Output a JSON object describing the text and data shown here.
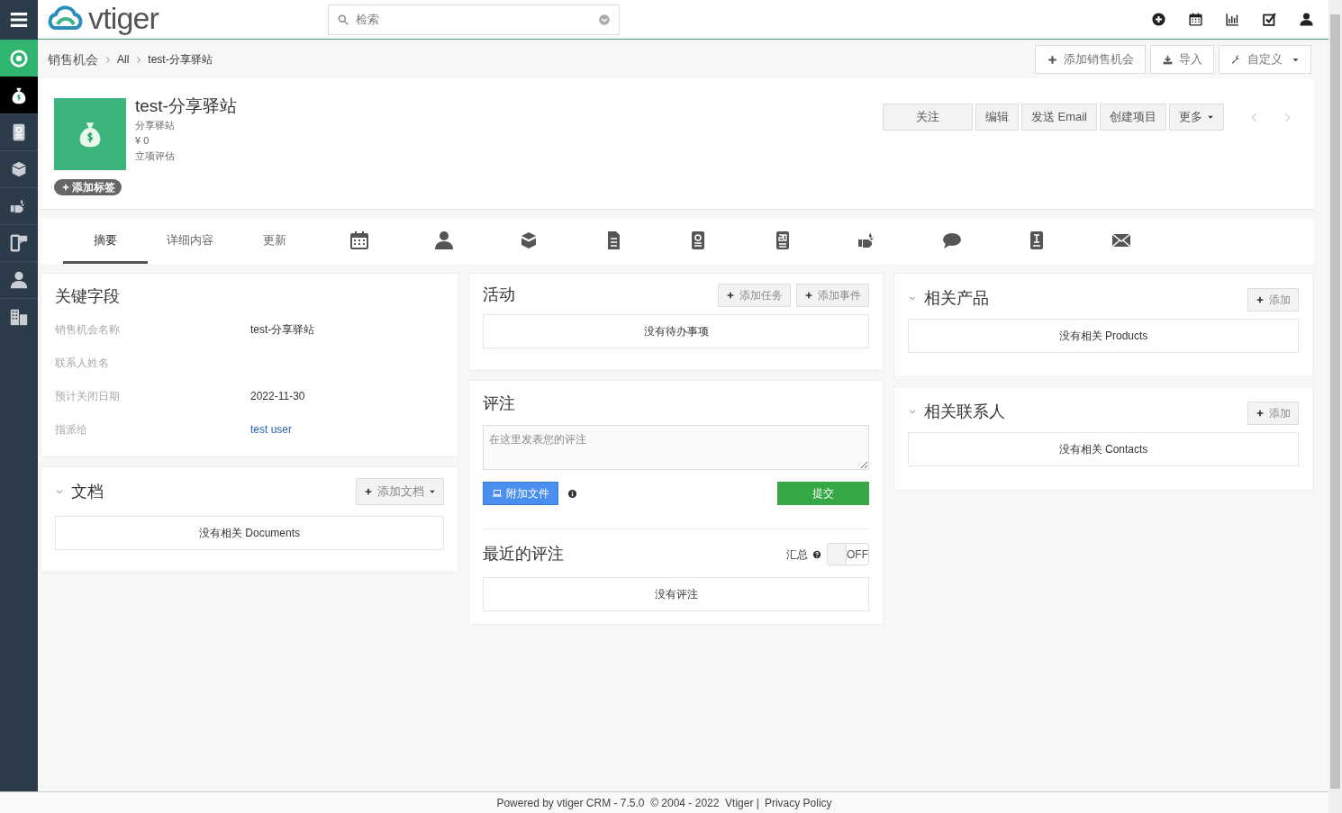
{
  "header": {
    "logo": "vtiger",
    "search": {
      "placeholder": "检索"
    },
    "icons": [
      {
        "kind": "plus"
      },
      {
        "kind": "calendar"
      },
      {
        "kind": "chart"
      },
      {
        "kind": "check"
      },
      {
        "kind": "user"
      }
    ]
  },
  "sidebar": {
    "items": [
      {
        "kind": "target",
        "selected": false
      },
      {
        "kind": "moneybag",
        "selected": true
      },
      {
        "kind": "quote",
        "selected": false
      },
      {
        "kind": "box",
        "selected": false
      },
      {
        "kind": "handshake",
        "selected": false
      },
      {
        "kind": "phone",
        "selected": false
      },
      {
        "kind": "user",
        "selected": false
      },
      {
        "kind": "building",
        "selected": false
      }
    ]
  },
  "breadcrumb": [
    "销售机会",
    "All",
    "test-分享驿站"
  ],
  "page_actions": [
    {
      "kind": "plus",
      "label": "添加销售机会",
      "dropdown": false
    },
    {
      "kind": "download",
      "label": "导入",
      "dropdown": false
    },
    {
      "kind": "wrench",
      "label": "自定义",
      "dropdown": true
    }
  ],
  "record": {
    "title": "test-分享驿站",
    "lines": [
      "分享驿站",
      "¥ 0",
      "立项评估"
    ],
    "tag_button": "添加标签",
    "actions": [
      {
        "label": "关注",
        "dropdown": false
      },
      {
        "label": "编辑",
        "dropdown": false
      },
      {
        "label": "发送 Email",
        "dropdown": false
      },
      {
        "label": "创建项目",
        "dropdown": false
      },
      {
        "label": "更多",
        "dropdown": true
      }
    ]
  },
  "tabs": [
    {
      "kind": "text",
      "label": "摘要",
      "selected": true
    },
    {
      "kind": "text",
      "label": "详细内容",
      "selected": false
    },
    {
      "kind": "text",
      "label": "更新",
      "selected": false
    },
    {
      "kind": "calendar",
      "selected": false
    },
    {
      "kind": "user",
      "selected": false
    },
    {
      "kind": "box",
      "selected": false
    },
    {
      "kind": "document",
      "selected": false
    },
    {
      "kind": "quote",
      "selected": false
    },
    {
      "kind": "salesorder",
      "selected": false
    },
    {
      "kind": "handshake",
      "selected": false
    },
    {
      "kind": "comment",
      "selected": false
    },
    {
      "kind": "invoice",
      "selected": false
    },
    {
      "kind": "mail",
      "selected": false
    }
  ],
  "key_fields": {
    "title": "关键字段",
    "fields": [
      {
        "label": "销售机会名称",
        "value": "test-分享驿站",
        "link": false
      },
      {
        "label": "联系人姓名"
      },
      {
        "label": "预计关闭日期",
        "value": "2022-11-30",
        "link": false
      },
      {
        "label": "指派给",
        "value": "test user",
        "link": true
      }
    ]
  },
  "documents": {
    "title": "文档",
    "button": "添加文档",
    "empty": "没有相关 Documents"
  },
  "activities": {
    "title": "活动",
    "buttons": [
      "添加任务",
      "添加事件"
    ],
    "empty": "没有待办事项"
  },
  "comments": {
    "title": "评注",
    "placeholder": "在这里发表您的评注",
    "attach": "附加文件",
    "submit": "提交",
    "recent_title": "最近的评注",
    "summary_label": "汇总",
    "summary_toggle": {
      "label": "OFF",
      "on": false
    },
    "empty": "没有评注"
  },
  "related": [
    {
      "title": "相关产品",
      "button": "添加",
      "empty": "没有相关 Products"
    },
    {
      "title": "相关联系人",
      "button": "添加",
      "empty": "没有相关 Contacts"
    }
  ],
  "footer": {
    "text": "Powered by vtiger CRM - 7.5.0  © 2004 - 2022  Vtiger |",
    "link": "Privacy Policy"
  }
}
